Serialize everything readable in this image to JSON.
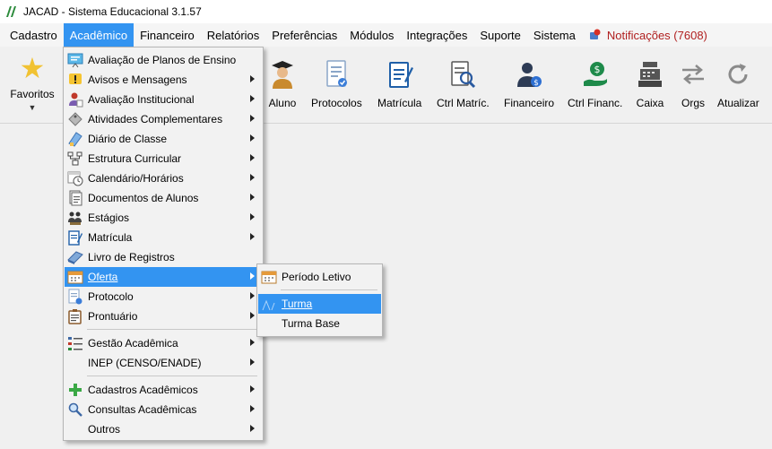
{
  "window": {
    "title": "JACAD - Sistema Educacional 3.1.57"
  },
  "menubar": {
    "items": [
      "Cadastro",
      "Acadêmico",
      "Financeiro",
      "Relatórios",
      "Preferências",
      "Módulos",
      "Integrações",
      "Suporte",
      "Sistema"
    ],
    "notifications": "Notificações (7608)"
  },
  "toolbar": {
    "favorites": "Favoritos",
    "buttons": [
      "Aluno",
      "Protocolos",
      "Matrícula",
      "Ctrl Matríc.",
      "Financeiro",
      "Ctrl Financ.",
      "Caixa",
      "Orgs",
      "Atualizar"
    ]
  },
  "academico_menu": {
    "items": [
      "Avaliação de Planos de Ensino",
      "Avisos e Mensagens",
      "Avaliação Institucional",
      "Atividades Complementares",
      "Diário de Classe",
      "Estrutura Curricular",
      "Calendário/Horários",
      "Documentos de Alunos",
      "Estágios",
      "Matrícula",
      "Livro de Registros",
      "Oferta",
      "Protocolo",
      "Prontuário",
      "Gestão Acadêmica",
      "INEP (CENSO/ENADE)",
      "Cadastros Acadêmicos",
      "Consultas Acadêmicas",
      "Outros"
    ]
  },
  "oferta_submenu": {
    "items": [
      "Período Letivo",
      "Turma",
      "Turma Base"
    ]
  },
  "colors": {
    "highlight": "#3394f1",
    "notification": "#b02020"
  }
}
